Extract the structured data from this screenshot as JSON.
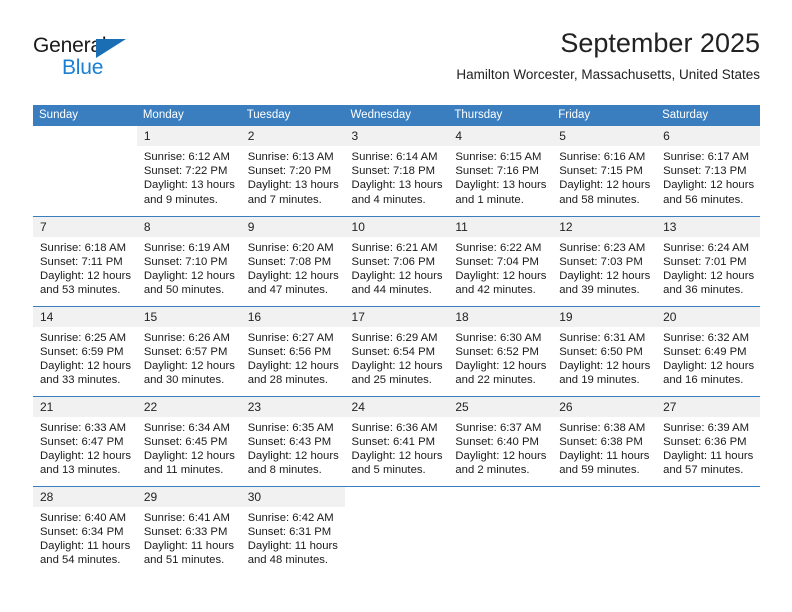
{
  "logo": {
    "word_one": "General",
    "word_two": "Blue",
    "triangle_color": "#1a6fb4",
    "blue_color": "#1a7fd4"
  },
  "header": {
    "title": "September 2025",
    "subtitle": "Hamilton Worcester, Massachusetts, United States"
  },
  "theme": {
    "header_bg": "#3a7ebf",
    "header_text": "#ffffff",
    "daynum_bg": "#f1f1f1",
    "row_divider": "#3a7ebf",
    "body_text": "#1a1a1a"
  },
  "weekdays": [
    "Sunday",
    "Monday",
    "Tuesday",
    "Wednesday",
    "Thursday",
    "Friday",
    "Saturday"
  ],
  "labels": {
    "sunrise": "Sunrise:",
    "sunset": "Sunset:",
    "daylight": "Daylight:"
  },
  "weeks": [
    [
      {
        "day": ""
      },
      {
        "day": "1",
        "sunrise": "Sunrise: 6:12 AM",
        "sunset": "Sunset: 7:22 PM",
        "daylight": "Daylight: 13 hours and 9 minutes."
      },
      {
        "day": "2",
        "sunrise": "Sunrise: 6:13 AM",
        "sunset": "Sunset: 7:20 PM",
        "daylight": "Daylight: 13 hours and 7 minutes."
      },
      {
        "day": "3",
        "sunrise": "Sunrise: 6:14 AM",
        "sunset": "Sunset: 7:18 PM",
        "daylight": "Daylight: 13 hours and 4 minutes."
      },
      {
        "day": "4",
        "sunrise": "Sunrise: 6:15 AM",
        "sunset": "Sunset: 7:16 PM",
        "daylight": "Daylight: 13 hours and 1 minute."
      },
      {
        "day": "5",
        "sunrise": "Sunrise: 6:16 AM",
        "sunset": "Sunset: 7:15 PM",
        "daylight": "Daylight: 12 hours and 58 minutes."
      },
      {
        "day": "6",
        "sunrise": "Sunrise: 6:17 AM",
        "sunset": "Sunset: 7:13 PM",
        "daylight": "Daylight: 12 hours and 56 minutes."
      }
    ],
    [
      {
        "day": "7",
        "sunrise": "Sunrise: 6:18 AM",
        "sunset": "Sunset: 7:11 PM",
        "daylight": "Daylight: 12 hours and 53 minutes."
      },
      {
        "day": "8",
        "sunrise": "Sunrise: 6:19 AM",
        "sunset": "Sunset: 7:10 PM",
        "daylight": "Daylight: 12 hours and 50 minutes."
      },
      {
        "day": "9",
        "sunrise": "Sunrise: 6:20 AM",
        "sunset": "Sunset: 7:08 PM",
        "daylight": "Daylight: 12 hours and 47 minutes."
      },
      {
        "day": "10",
        "sunrise": "Sunrise: 6:21 AM",
        "sunset": "Sunset: 7:06 PM",
        "daylight": "Daylight: 12 hours and 44 minutes."
      },
      {
        "day": "11",
        "sunrise": "Sunrise: 6:22 AM",
        "sunset": "Sunset: 7:04 PM",
        "daylight": "Daylight: 12 hours and 42 minutes."
      },
      {
        "day": "12",
        "sunrise": "Sunrise: 6:23 AM",
        "sunset": "Sunset: 7:03 PM",
        "daylight": "Daylight: 12 hours and 39 minutes."
      },
      {
        "day": "13",
        "sunrise": "Sunrise: 6:24 AM",
        "sunset": "Sunset: 7:01 PM",
        "daylight": "Daylight: 12 hours and 36 minutes."
      }
    ],
    [
      {
        "day": "14",
        "sunrise": "Sunrise: 6:25 AM",
        "sunset": "Sunset: 6:59 PM",
        "daylight": "Daylight: 12 hours and 33 minutes."
      },
      {
        "day": "15",
        "sunrise": "Sunrise: 6:26 AM",
        "sunset": "Sunset: 6:57 PM",
        "daylight": "Daylight: 12 hours and 30 minutes."
      },
      {
        "day": "16",
        "sunrise": "Sunrise: 6:27 AM",
        "sunset": "Sunset: 6:56 PM",
        "daylight": "Daylight: 12 hours and 28 minutes."
      },
      {
        "day": "17",
        "sunrise": "Sunrise: 6:29 AM",
        "sunset": "Sunset: 6:54 PM",
        "daylight": "Daylight: 12 hours and 25 minutes."
      },
      {
        "day": "18",
        "sunrise": "Sunrise: 6:30 AM",
        "sunset": "Sunset: 6:52 PM",
        "daylight": "Daylight: 12 hours and 22 minutes."
      },
      {
        "day": "19",
        "sunrise": "Sunrise: 6:31 AM",
        "sunset": "Sunset: 6:50 PM",
        "daylight": "Daylight: 12 hours and 19 minutes."
      },
      {
        "day": "20",
        "sunrise": "Sunrise: 6:32 AM",
        "sunset": "Sunset: 6:49 PM",
        "daylight": "Daylight: 12 hours and 16 minutes."
      }
    ],
    [
      {
        "day": "21",
        "sunrise": "Sunrise: 6:33 AM",
        "sunset": "Sunset: 6:47 PM",
        "daylight": "Daylight: 12 hours and 13 minutes."
      },
      {
        "day": "22",
        "sunrise": "Sunrise: 6:34 AM",
        "sunset": "Sunset: 6:45 PM",
        "daylight": "Daylight: 12 hours and 11 minutes."
      },
      {
        "day": "23",
        "sunrise": "Sunrise: 6:35 AM",
        "sunset": "Sunset: 6:43 PM",
        "daylight": "Daylight: 12 hours and 8 minutes."
      },
      {
        "day": "24",
        "sunrise": "Sunrise: 6:36 AM",
        "sunset": "Sunset: 6:41 PM",
        "daylight": "Daylight: 12 hours and 5 minutes."
      },
      {
        "day": "25",
        "sunrise": "Sunrise: 6:37 AM",
        "sunset": "Sunset: 6:40 PM",
        "daylight": "Daylight: 12 hours and 2 minutes."
      },
      {
        "day": "26",
        "sunrise": "Sunrise: 6:38 AM",
        "sunset": "Sunset: 6:38 PM",
        "daylight": "Daylight: 11 hours and 59 minutes."
      },
      {
        "day": "27",
        "sunrise": "Sunrise: 6:39 AM",
        "sunset": "Sunset: 6:36 PM",
        "daylight": "Daylight: 11 hours and 57 minutes."
      }
    ],
    [
      {
        "day": "28",
        "sunrise": "Sunrise: 6:40 AM",
        "sunset": "Sunset: 6:34 PM",
        "daylight": "Daylight: 11 hours and 54 minutes."
      },
      {
        "day": "29",
        "sunrise": "Sunrise: 6:41 AM",
        "sunset": "Sunset: 6:33 PM",
        "daylight": "Daylight: 11 hours and 51 minutes."
      },
      {
        "day": "30",
        "sunrise": "Sunrise: 6:42 AM",
        "sunset": "Sunset: 6:31 PM",
        "daylight": "Daylight: 11 hours and 48 minutes."
      },
      {
        "day": ""
      },
      {
        "day": ""
      },
      {
        "day": ""
      },
      {
        "day": ""
      }
    ]
  ]
}
